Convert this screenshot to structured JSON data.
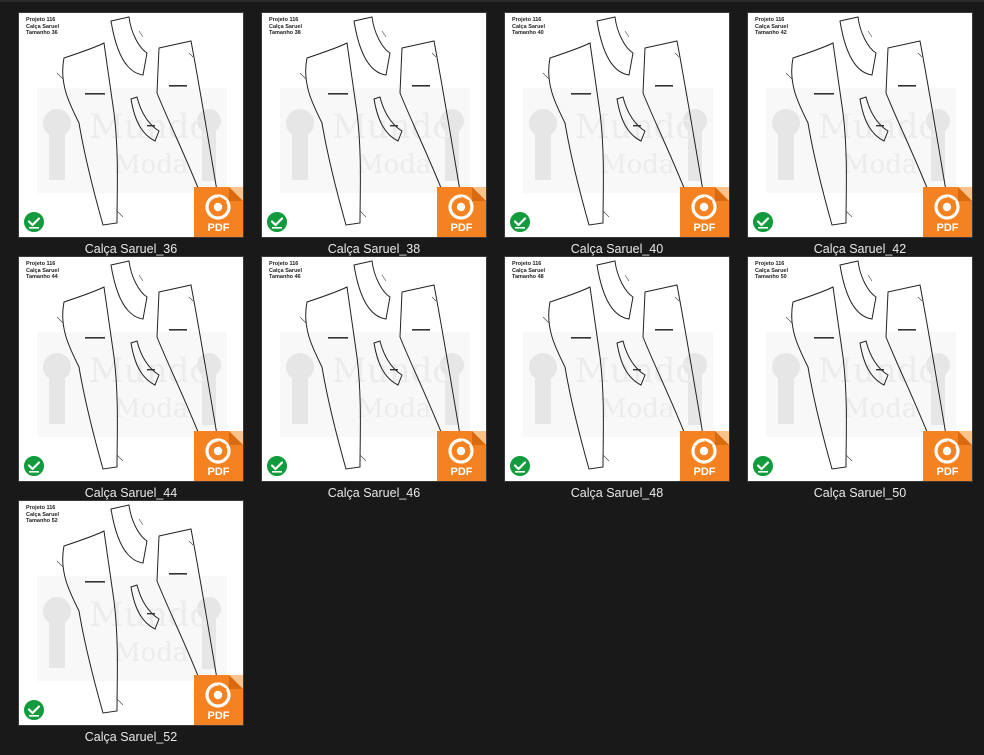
{
  "view": "thumbnails",
  "files": [
    {
      "name": "Calça Saruel_36",
      "type": "PDF",
      "status": "synced",
      "header": "Projeto 116\nCalça Saruel\nTamanho 36"
    },
    {
      "name": "Calça Saruel_38",
      "type": "PDF",
      "status": "synced",
      "header": "Projeto 116\nCalça Saruel\nTamanho 38"
    },
    {
      "name": "Calça Saruel_40",
      "type": "PDF",
      "status": "synced",
      "header": "Projeto 116\nCalça Saruel\nTamanho 40"
    },
    {
      "name": "Calça Saruel_42",
      "type": "PDF",
      "status": "synced",
      "header": "Projeto 116\nCalça Saruel\nTamanho 42"
    },
    {
      "name": "Calça Saruel_44",
      "type": "PDF",
      "status": "synced",
      "header": "Projeto 116\nCalça Saruel\nTamanho 44"
    },
    {
      "name": "Calça Saruel_46",
      "type": "PDF",
      "status": "synced",
      "header": "Projeto 116\nCalça Saruel\nTamanho 46"
    },
    {
      "name": "Calça Saruel_48",
      "type": "PDF",
      "status": "synced",
      "header": "Projeto 116\nCalça Saruel\nTamanho 48"
    },
    {
      "name": "Calça Saruel_50",
      "type": "PDF",
      "status": "synced",
      "header": "Projeto 116\nCalça Saruel\nTamanho 50"
    },
    {
      "name": "Calça Saruel_52",
      "type": "PDF",
      "status": "synced",
      "header": "Projeto 116\nCalça Saruel\nTamanho 52"
    }
  ],
  "badge_text": "PDF",
  "colors": {
    "background": "#191919",
    "label": "#e8e8e8",
    "pdf_badge": "#f58220",
    "status_check": "#119b3c"
  },
  "icons": {
    "status": "check-circle-icon",
    "file_type": "foxit-pdf-icon"
  }
}
